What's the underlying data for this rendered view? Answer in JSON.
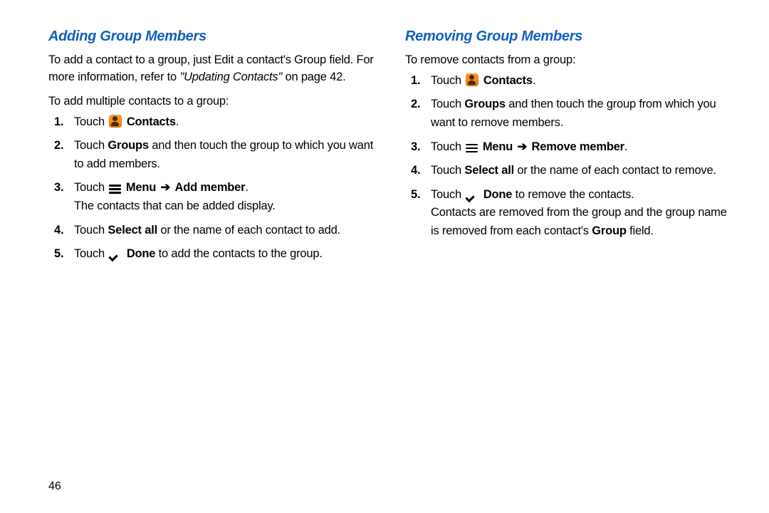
{
  "page_number": "46",
  "left": {
    "heading": "Adding Group Members",
    "intro1a": "To add a contact to a group, just Edit a contact's Group field. For more information, refer to ",
    "intro1_ref": "\"Updating Contacts\"",
    "intro1b": " on page 42.",
    "intro2": "To add multiple contacts to a group:",
    "steps": [
      {
        "n": "1.",
        "pre": "Touch ",
        "icon": "contacts",
        "post_bold": "Contacts",
        "post": "."
      },
      {
        "n": "2.",
        "pre": "Touch ",
        "bold": "Groups",
        "post": " and then touch the group to which you want to add members."
      },
      {
        "n": "3.",
        "pre": "Touch ",
        "icon": "menu",
        "post_bold_a": "Menu",
        "arrow": "➔",
        "post_bold_b": "Add member",
        "post": ".",
        "tail": "The contacts that can be added display."
      },
      {
        "n": "4.",
        "pre": "Touch ",
        "bold": "Select all",
        "post": " or the name of each contact to add."
      },
      {
        "n": "5.",
        "pre": "Touch ",
        "icon": "check",
        "post_bold": "Done",
        "post": " to add the contacts to the group."
      }
    ]
  },
  "right": {
    "heading": "Removing Group Members",
    "intro": "To remove contacts from a group:",
    "steps": [
      {
        "n": "1.",
        "pre": "Touch ",
        "icon": "contacts",
        "post_bold": "Contacts",
        "post": "."
      },
      {
        "n": "2.",
        "pre": "Touch ",
        "bold": "Groups",
        "post": " and then touch the group from which you want to remove members."
      },
      {
        "n": "3.",
        "pre": "Touch ",
        "icon": "menu",
        "post_bold_a": "Menu",
        "arrow": "➔",
        "post_bold_b": "Remove member",
        "post": "."
      },
      {
        "n": "4.",
        "pre": "Touch ",
        "bold": "Select all",
        "post": " or the name of each contact to remove."
      },
      {
        "n": "5.",
        "pre": "Touch ",
        "icon": "check",
        "post_bold": "Done",
        "post": " to remove the contacts.",
        "tail_a": "Contacts are removed from the group and the group name is removed from each contact's ",
        "tail_bold": "Group",
        "tail_b": " field."
      }
    ]
  }
}
